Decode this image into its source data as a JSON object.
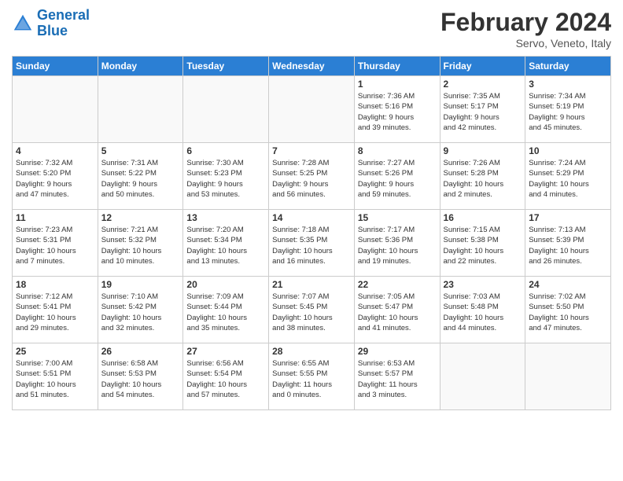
{
  "logo": {
    "line1": "General",
    "line2": "Blue"
  },
  "header": {
    "title": "February 2024",
    "subtitle": "Servo, Veneto, Italy"
  },
  "weekdays": [
    "Sunday",
    "Monday",
    "Tuesday",
    "Wednesday",
    "Thursday",
    "Friday",
    "Saturday"
  ],
  "weeks": [
    [
      {
        "day": "",
        "info": ""
      },
      {
        "day": "",
        "info": ""
      },
      {
        "day": "",
        "info": ""
      },
      {
        "day": "",
        "info": ""
      },
      {
        "day": "1",
        "info": "Sunrise: 7:36 AM\nSunset: 5:16 PM\nDaylight: 9 hours\nand 39 minutes."
      },
      {
        "day": "2",
        "info": "Sunrise: 7:35 AM\nSunset: 5:17 PM\nDaylight: 9 hours\nand 42 minutes."
      },
      {
        "day": "3",
        "info": "Sunrise: 7:34 AM\nSunset: 5:19 PM\nDaylight: 9 hours\nand 45 minutes."
      }
    ],
    [
      {
        "day": "4",
        "info": "Sunrise: 7:32 AM\nSunset: 5:20 PM\nDaylight: 9 hours\nand 47 minutes."
      },
      {
        "day": "5",
        "info": "Sunrise: 7:31 AM\nSunset: 5:22 PM\nDaylight: 9 hours\nand 50 minutes."
      },
      {
        "day": "6",
        "info": "Sunrise: 7:30 AM\nSunset: 5:23 PM\nDaylight: 9 hours\nand 53 minutes."
      },
      {
        "day": "7",
        "info": "Sunrise: 7:28 AM\nSunset: 5:25 PM\nDaylight: 9 hours\nand 56 minutes."
      },
      {
        "day": "8",
        "info": "Sunrise: 7:27 AM\nSunset: 5:26 PM\nDaylight: 9 hours\nand 59 minutes."
      },
      {
        "day": "9",
        "info": "Sunrise: 7:26 AM\nSunset: 5:28 PM\nDaylight: 10 hours\nand 2 minutes."
      },
      {
        "day": "10",
        "info": "Sunrise: 7:24 AM\nSunset: 5:29 PM\nDaylight: 10 hours\nand 4 minutes."
      }
    ],
    [
      {
        "day": "11",
        "info": "Sunrise: 7:23 AM\nSunset: 5:31 PM\nDaylight: 10 hours\nand 7 minutes."
      },
      {
        "day": "12",
        "info": "Sunrise: 7:21 AM\nSunset: 5:32 PM\nDaylight: 10 hours\nand 10 minutes."
      },
      {
        "day": "13",
        "info": "Sunrise: 7:20 AM\nSunset: 5:34 PM\nDaylight: 10 hours\nand 13 minutes."
      },
      {
        "day": "14",
        "info": "Sunrise: 7:18 AM\nSunset: 5:35 PM\nDaylight: 10 hours\nand 16 minutes."
      },
      {
        "day": "15",
        "info": "Sunrise: 7:17 AM\nSunset: 5:36 PM\nDaylight: 10 hours\nand 19 minutes."
      },
      {
        "day": "16",
        "info": "Sunrise: 7:15 AM\nSunset: 5:38 PM\nDaylight: 10 hours\nand 22 minutes."
      },
      {
        "day": "17",
        "info": "Sunrise: 7:13 AM\nSunset: 5:39 PM\nDaylight: 10 hours\nand 26 minutes."
      }
    ],
    [
      {
        "day": "18",
        "info": "Sunrise: 7:12 AM\nSunset: 5:41 PM\nDaylight: 10 hours\nand 29 minutes."
      },
      {
        "day": "19",
        "info": "Sunrise: 7:10 AM\nSunset: 5:42 PM\nDaylight: 10 hours\nand 32 minutes."
      },
      {
        "day": "20",
        "info": "Sunrise: 7:09 AM\nSunset: 5:44 PM\nDaylight: 10 hours\nand 35 minutes."
      },
      {
        "day": "21",
        "info": "Sunrise: 7:07 AM\nSunset: 5:45 PM\nDaylight: 10 hours\nand 38 minutes."
      },
      {
        "day": "22",
        "info": "Sunrise: 7:05 AM\nSunset: 5:47 PM\nDaylight: 10 hours\nand 41 minutes."
      },
      {
        "day": "23",
        "info": "Sunrise: 7:03 AM\nSunset: 5:48 PM\nDaylight: 10 hours\nand 44 minutes."
      },
      {
        "day": "24",
        "info": "Sunrise: 7:02 AM\nSunset: 5:50 PM\nDaylight: 10 hours\nand 47 minutes."
      }
    ],
    [
      {
        "day": "25",
        "info": "Sunrise: 7:00 AM\nSunset: 5:51 PM\nDaylight: 10 hours\nand 51 minutes."
      },
      {
        "day": "26",
        "info": "Sunrise: 6:58 AM\nSunset: 5:53 PM\nDaylight: 10 hours\nand 54 minutes."
      },
      {
        "day": "27",
        "info": "Sunrise: 6:56 AM\nSunset: 5:54 PM\nDaylight: 10 hours\nand 57 minutes."
      },
      {
        "day": "28",
        "info": "Sunrise: 6:55 AM\nSunset: 5:55 PM\nDaylight: 11 hours\nand 0 minutes."
      },
      {
        "day": "29",
        "info": "Sunrise: 6:53 AM\nSunset: 5:57 PM\nDaylight: 11 hours\nand 3 minutes."
      },
      {
        "day": "",
        "info": ""
      },
      {
        "day": "",
        "info": ""
      }
    ]
  ]
}
